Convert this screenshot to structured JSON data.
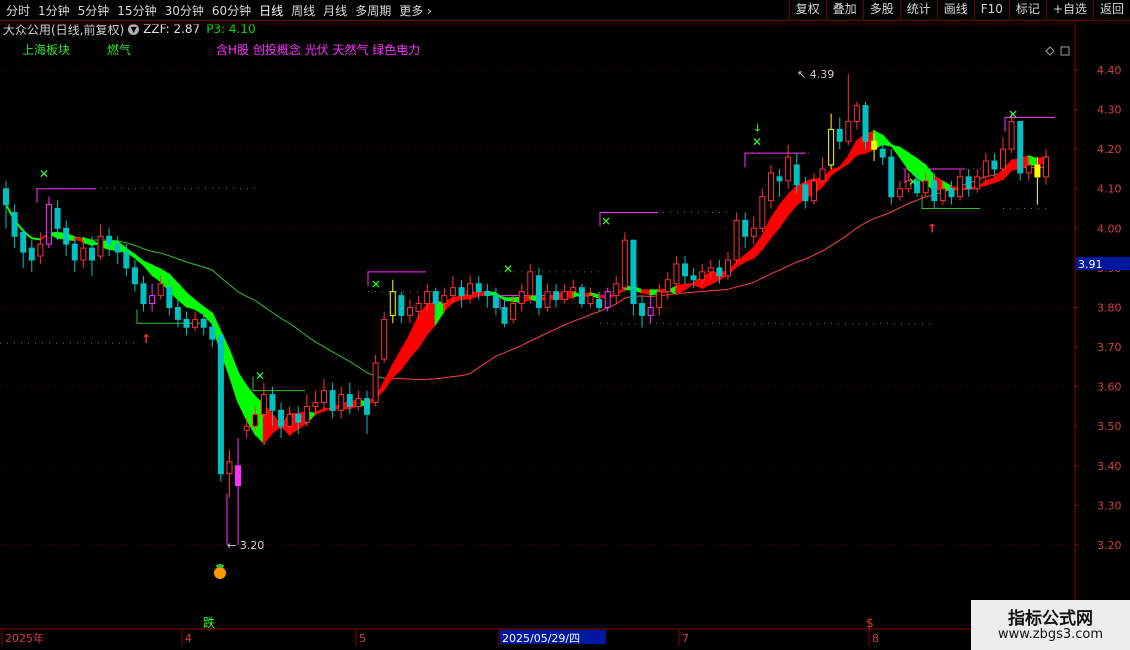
{
  "toolbar": {
    "left_items": [
      "分时",
      "1分钟",
      "5分钟",
      "15分钟",
      "30分钟",
      "60分钟",
      "日线",
      "周线",
      "月线",
      "多周期",
      "更多"
    ],
    "active_index": 6,
    "right_items": [
      "复权",
      "叠加",
      "多股",
      "统计",
      "画线",
      "F10",
      "标记",
      "+自选",
      "返回"
    ]
  },
  "info": {
    "title": "大众公用(日线,前复权)",
    "zzf": "ZZF: 2.87",
    "p3": "P3: 4.10"
  },
  "sectors": {
    "block": "上海板块",
    "industry": "燃气",
    "concepts": "含H股 创投概念 光伏 天然气 绿色电力"
  },
  "price_axis": {
    "labels": [
      "4.40",
      "4.30",
      "4.20",
      "4.10",
      "4.00",
      "3.90",
      "3.80",
      "3.70",
      "3.60",
      "3.50",
      "3.40",
      "3.30",
      "3.20"
    ],
    "current": "3.91"
  },
  "time_axis": {
    "labels": [
      "2025年",
      "4",
      "5",
      "2025/05/29/四",
      "7",
      "8"
    ]
  },
  "annotations": {
    "high": "4.39",
    "low": "3.20",
    "drop_marker": "跌",
    "dollar": "$"
  },
  "watermark": {
    "title": "指标公式网",
    "url": "www.zbgs3.com"
  },
  "colors": {
    "up": "#ff3030",
    "down": "#00c0c0",
    "ribbon_up": "#ff0000",
    "ribbon_down": "#00ff00",
    "ma": "#ff4040",
    "ma_green": "#30c030",
    "magenta": "#ff30ff",
    "yellow": "#ffff00",
    "axis": "#8b0000"
  },
  "chart_data": {
    "type": "candlestick",
    "y_range": [
      3.16,
      4.47
    ],
    "candles": [
      [
        4.1,
        4.06,
        4.12,
        4.0
      ],
      [
        4.04,
        3.98,
        4.06,
        3.95
      ],
      [
        3.99,
        3.94,
        4.0,
        3.9
      ],
      [
        3.95,
        3.92,
        3.97,
        3.89
      ],
      [
        3.93,
        3.96,
        3.99,
        3.91
      ],
      [
        3.96,
        4.06,
        4.08,
        3.95
      ],
      [
        4.05,
        4.0,
        4.07,
        3.97
      ],
      [
        4.0,
        3.96,
        4.02,
        3.93
      ],
      [
        3.96,
        3.92,
        3.98,
        3.89
      ],
      [
        3.92,
        3.95,
        3.97,
        3.9
      ],
      [
        3.95,
        3.92,
        3.98,
        3.88
      ],
      [
        3.93,
        3.98,
        4.01,
        3.92
      ],
      [
        3.98,
        3.96,
        4.0,
        3.93
      ],
      [
        3.96,
        3.94,
        3.98,
        3.91
      ],
      [
        3.94,
        3.9,
        3.96,
        3.88
      ],
      [
        3.9,
        3.86,
        3.92,
        3.84
      ],
      [
        3.86,
        3.81,
        3.88,
        3.79
      ],
      [
        3.81,
        3.83,
        3.86,
        3.79
      ],
      [
        3.83,
        3.86,
        3.88,
        3.82
      ],
      [
        3.85,
        3.8,
        3.87,
        3.78
      ],
      [
        3.8,
        3.77,
        3.82,
        3.75
      ],
      [
        3.77,
        3.75,
        3.79,
        3.73
      ],
      [
        3.75,
        3.77,
        3.79,
        3.74
      ],
      [
        3.77,
        3.75,
        3.79,
        3.73
      ],
      [
        3.75,
        3.72,
        3.77,
        3.7
      ],
      [
        3.73,
        3.38,
        3.69,
        3.36
      ],
      [
        3.38,
        3.41,
        3.44,
        3.32
      ],
      [
        3.4,
        3.35,
        3.47,
        3.2
      ],
      [
        3.49,
        3.5,
        3.52,
        3.47
      ],
      [
        3.5,
        3.53,
        3.55,
        3.49
      ],
      [
        3.53,
        3.58,
        3.61,
        3.52
      ],
      [
        3.58,
        3.54,
        3.6,
        3.5
      ],
      [
        3.54,
        3.5,
        3.56,
        3.47
      ],
      [
        3.5,
        3.53,
        3.55,
        3.48
      ],
      [
        3.53,
        3.51,
        3.55,
        3.48
      ],
      [
        3.51,
        3.55,
        3.58,
        3.5
      ],
      [
        3.55,
        3.56,
        3.59,
        3.53
      ],
      [
        3.56,
        3.59,
        3.62,
        3.54
      ],
      [
        3.59,
        3.54,
        3.61,
        3.52
      ],
      [
        3.54,
        3.58,
        3.6,
        3.52
      ],
      [
        3.58,
        3.55,
        3.61,
        3.53
      ],
      [
        3.55,
        3.57,
        3.59,
        3.54
      ],
      [
        3.57,
        3.53,
        3.59,
        3.48
      ],
      [
        3.56,
        3.66,
        3.68,
        3.55
      ],
      [
        3.67,
        3.77,
        3.79,
        3.66
      ],
      [
        3.78,
        3.84,
        3.87,
        3.76
      ],
      [
        3.83,
        3.78,
        3.84,
        3.76
      ],
      [
        3.78,
        3.8,
        3.82,
        3.76
      ],
      [
        3.79,
        3.81,
        3.83,
        3.77
      ],
      [
        3.81,
        3.84,
        3.86,
        3.79
      ],
      [
        3.84,
        3.81,
        3.85,
        3.78
      ],
      [
        3.81,
        3.83,
        3.85,
        3.79
      ],
      [
        3.83,
        3.85,
        3.88,
        3.81
      ],
      [
        3.85,
        3.83,
        3.87,
        3.8
      ],
      [
        3.83,
        3.86,
        3.88,
        3.81
      ],
      [
        3.86,
        3.84,
        3.88,
        3.82
      ],
      [
        3.84,
        3.83,
        3.86,
        3.8
      ],
      [
        3.83,
        3.8,
        3.85,
        3.78
      ],
      [
        3.8,
        3.76,
        3.82,
        3.75
      ],
      [
        3.77,
        3.81,
        3.83,
        3.76
      ],
      [
        3.81,
        3.84,
        3.86,
        3.79
      ],
      [
        3.83,
        3.89,
        3.91,
        3.81
      ],
      [
        3.88,
        3.8,
        3.9,
        3.78
      ],
      [
        3.8,
        3.84,
        3.86,
        3.79
      ],
      [
        3.84,
        3.82,
        3.86,
        3.8
      ],
      [
        3.82,
        3.84,
        3.86,
        3.81
      ],
      [
        3.84,
        3.85,
        3.87,
        3.82
      ],
      [
        3.85,
        3.81,
        3.86,
        3.8
      ],
      [
        3.81,
        3.83,
        3.85,
        3.8
      ],
      [
        3.82,
        3.8,
        3.84,
        3.79
      ],
      [
        3.8,
        3.84,
        3.85,
        3.79
      ],
      [
        3.83,
        3.86,
        3.88,
        3.81
      ],
      [
        3.85,
        3.97,
        3.99,
        3.84
      ],
      [
        3.97,
        3.81,
        3.97,
        3.78
      ],
      [
        3.81,
        3.78,
        3.83,
        3.75
      ],
      [
        3.78,
        3.8,
        3.83,
        3.76
      ],
      [
        3.8,
        3.84,
        3.86,
        3.78
      ],
      [
        3.84,
        3.87,
        3.89,
        3.82
      ],
      [
        3.86,
        3.91,
        3.93,
        3.85
      ],
      [
        3.91,
        3.88,
        3.93,
        3.86
      ],
      [
        3.88,
        3.87,
        3.9,
        3.85
      ],
      [
        3.87,
        3.89,
        3.91,
        3.86
      ],
      [
        3.89,
        3.9,
        3.92,
        3.87
      ],
      [
        3.9,
        3.88,
        3.92,
        3.86
      ],
      [
        3.88,
        3.92,
        3.94,
        3.87
      ],
      [
        3.92,
        4.02,
        4.04,
        3.91
      ],
      [
        4.02,
        3.98,
        4.04,
        3.95
      ],
      [
        3.98,
        4.0,
        4.03,
        3.96
      ],
      [
        4.0,
        4.08,
        4.1,
        3.99
      ],
      [
        4.07,
        4.14,
        4.16,
        4.05
      ],
      [
        4.13,
        4.12,
        4.15,
        4.08
      ],
      [
        4.12,
        4.18,
        4.21,
        4.1
      ],
      [
        4.16,
        4.11,
        4.19,
        4.09
      ],
      [
        4.11,
        4.07,
        4.13,
        4.05
      ],
      [
        4.07,
        4.12,
        4.14,
        4.06
      ],
      [
        4.12,
        4.15,
        4.18,
        4.11
      ],
      [
        4.16,
        4.25,
        4.29,
        4.15
      ],
      [
        4.25,
        4.22,
        4.28,
        4.2
      ],
      [
        4.22,
        4.27,
        4.39,
        4.21
      ],
      [
        4.27,
        4.31,
        4.32,
        4.25
      ],
      [
        4.31,
        4.22,
        4.32,
        4.2
      ],
      [
        4.22,
        4.2,
        4.24,
        4.17
      ],
      [
        4.2,
        4.18,
        4.22,
        4.16
      ],
      [
        4.18,
        4.08,
        4.2,
        4.06
      ],
      [
        4.08,
        4.1,
        4.12,
        4.07
      ],
      [
        4.1,
        4.12,
        4.14,
        4.09
      ],
      [
        4.12,
        4.09,
        4.14,
        4.08
      ],
      [
        4.09,
        4.12,
        4.14,
        4.08
      ],
      [
        4.12,
        4.07,
        4.14,
        4.05
      ],
      [
        4.07,
        4.1,
        4.12,
        4.06
      ],
      [
        4.1,
        4.08,
        4.12,
        4.06
      ],
      [
        4.08,
        4.13,
        4.15,
        4.07
      ],
      [
        4.13,
        4.1,
        4.15,
        4.08
      ],
      [
        4.1,
        4.13,
        4.15,
        4.09
      ],
      [
        4.13,
        4.17,
        4.19,
        4.11
      ],
      [
        4.17,
        4.15,
        4.19,
        4.13
      ],
      [
        4.15,
        4.2,
        4.23,
        4.14
      ],
      [
        4.2,
        4.27,
        4.29,
        4.19
      ],
      [
        4.27,
        4.14,
        4.27,
        4.12
      ],
      [
        4.14,
        4.16,
        4.18,
        4.12
      ],
      [
        4.16,
        4.13,
        4.18,
        4.06
      ],
      [
        4.13,
        4.18,
        4.2,
        4.11
      ]
    ]
  }
}
